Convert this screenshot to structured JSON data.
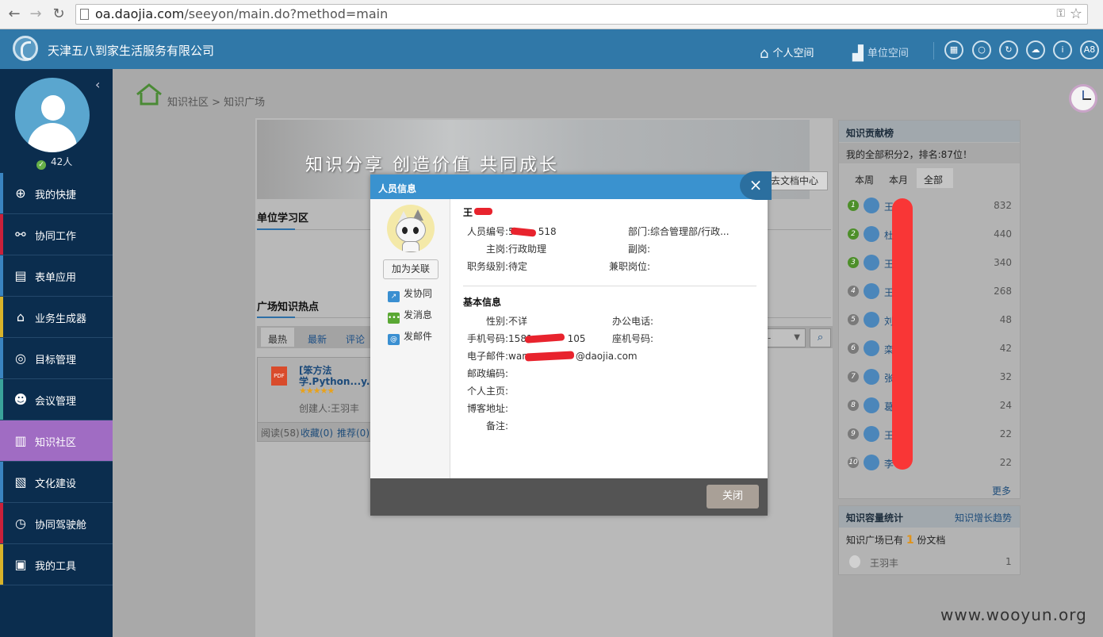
{
  "browser": {
    "url_host": "oa.daojia.com",
    "url_path": "/seeyon/main.do?method=main"
  },
  "header": {
    "company": "天津五八到家生活服务有限公司",
    "personal_space": "个人空间",
    "unit_space": "单位空间",
    "avatar_badge": "A8"
  },
  "sidebar": {
    "online_count": "42人",
    "items": [
      {
        "label": "我的快捷",
        "icon": "plus-circle-icon",
        "color": "#3a84c1"
      },
      {
        "label": "协同工作",
        "icon": "share-icon",
        "color": "#c9203a"
      },
      {
        "label": "表单应用",
        "icon": "form-icon",
        "color": "#3a84c1"
      },
      {
        "label": "业务生成器",
        "icon": "home-chart-icon",
        "color": "#d8b32a"
      },
      {
        "label": "目标管理",
        "icon": "target-icon",
        "color": "#3a84c1"
      },
      {
        "label": "会议管理",
        "icon": "meeting-icon",
        "color": "#3aa39a"
      },
      {
        "label": "知识社区",
        "icon": "book-icon",
        "color": "#a06cc3"
      },
      {
        "label": "文化建设",
        "icon": "culture-icon",
        "color": "#3a84c1"
      },
      {
        "label": "协同驾驶舱",
        "icon": "dashboard-icon",
        "color": "#c9203a"
      },
      {
        "label": "我的工具",
        "icon": "toolbox-icon",
        "color": "#d8b32a"
      }
    ]
  },
  "breadcrumb": "知识社区 > 知识广场",
  "banner": {
    "slogan": "知识分享 创造价值 共同成长",
    "doc_center": "去文档中心"
  },
  "sections": {
    "unit_study": "单位学习区",
    "hot": "广场知识热点"
  },
  "filter_tabs": [
    "最热",
    "最新",
    "评论"
  ],
  "card": {
    "title": "[笨方法学.Python...y...",
    "stars": "★★★★★",
    "creator": "创建人:王羽丰",
    "reads": "阅读(58)",
    "fav": "收藏(0)",
    "rec": "推荐(0)"
  },
  "rank": {
    "title": "知识贡献榜",
    "my_score": "我的全部积分2，排名:87位！",
    "tabs": [
      "本周",
      "本月",
      "全部"
    ],
    "rows": [
      {
        "num": "1",
        "name": "王",
        "score": "832"
      },
      {
        "num": "2",
        "name": "杜",
        "score": "440"
      },
      {
        "num": "3",
        "name": "王",
        "score": "340"
      },
      {
        "num": "4",
        "name": "王",
        "score": "268"
      },
      {
        "num": "5",
        "name": "刘",
        "score": "48"
      },
      {
        "num": "6",
        "name": "栾",
        "score": "42"
      },
      {
        "num": "7",
        "name": "张",
        "score": "32"
      },
      {
        "num": "8",
        "name": "葛",
        "score": "24"
      },
      {
        "num": "9",
        "name": "王",
        "score": "22"
      },
      {
        "num": "10",
        "name": "李",
        "score": "22"
      }
    ],
    "more": "更多"
  },
  "stats": {
    "title": "知识容量统计",
    "trend": "知识增长趋势",
    "line_prefix": "知识广场已有",
    "count": "1",
    "line_suffix": "份文档",
    "user": "王羽丰",
    "user_count": "1"
  },
  "watermark": "www.wooyun.org",
  "dialog": {
    "title": "人员信息",
    "add_relation": "加为关联",
    "actions": [
      "发协同",
      "发消息",
      "发邮件"
    ],
    "name": "王",
    "emp_no": "人员编号:5",
    "emp_no_tail": "518",
    "dept": "部门:综合管理部/行政...",
    "main_post": "主岗:行政助理",
    "vice_post": "副岗:",
    "level": "职务级别:待定",
    "part_time": "兼职岗位:",
    "basic_info": "基本信息",
    "gender": "性别:不详",
    "office_phone": "办公电话:",
    "mobile": "手机号码:1581",
    "mobile_tail": "105",
    "landline": "座机号码:",
    "email_prefix": "电子邮件:wan",
    "email_suffix": "@daojia.com",
    "postcode": "邮政编码:",
    "homepage": "个人主页:",
    "blog": "博客地址:",
    "note": "备注:",
    "close": "关闭"
  }
}
